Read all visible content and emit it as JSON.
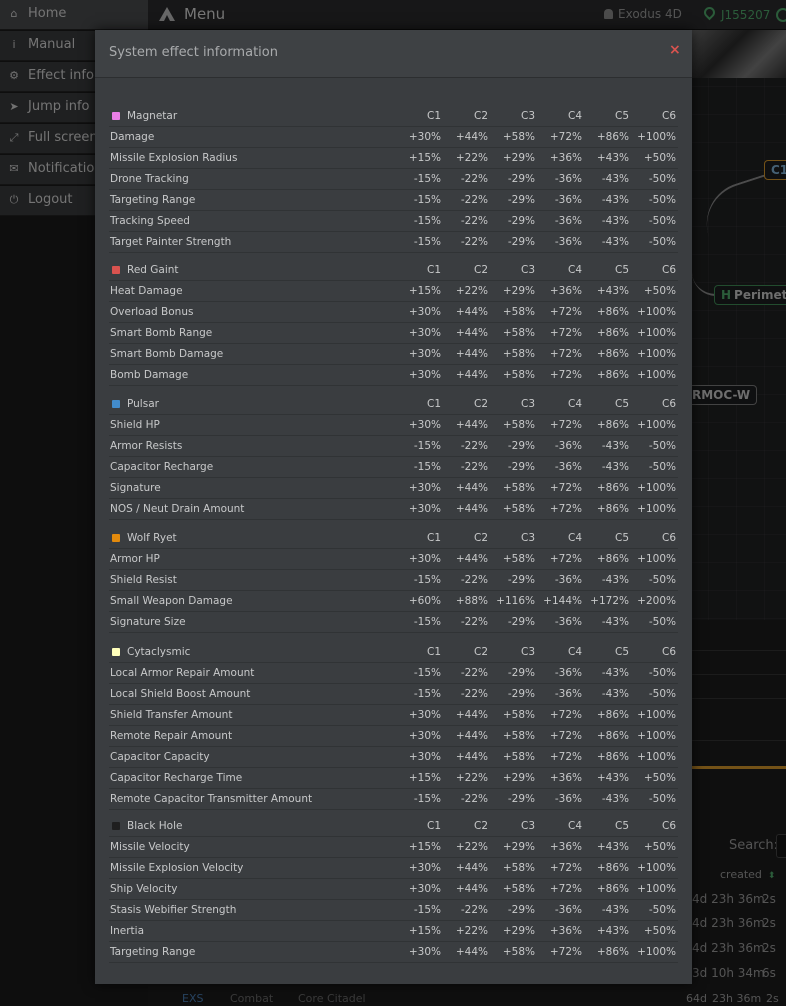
{
  "sidebar": {
    "items": [
      {
        "label": "Home",
        "icon": "home-icon"
      },
      {
        "label": "Manual",
        "icon": "info-icon"
      },
      {
        "label": "Effect info",
        "icon": "gears-icon"
      },
      {
        "label": "Jump info",
        "icon": "plane-icon"
      },
      {
        "label": "Full screen",
        "icon": "expand-icon"
      },
      {
        "label": "Notification",
        "icon": "bell-icon"
      },
      {
        "label": "Logout",
        "icon": "power-icon"
      }
    ]
  },
  "header": {
    "title": "Menu",
    "pilot": "Exodus 4D",
    "system": "J155207"
  },
  "map": {
    "nodes": [
      {
        "id": "c1",
        "label": "C1"
      },
      {
        "id": "perimeter",
        "tag": "H",
        "label": "Perimete"
      },
      {
        "id": "armoc",
        "label": "RMOC-W"
      }
    ]
  },
  "table": {
    "search_label": "Search:",
    "created_header": "created",
    "sort_glyph": "⬍",
    "rows": [
      {
        "age": "4d  23h 36m",
        "sec": "2s"
      },
      {
        "age": "4d  23h 36m",
        "sec": "2s"
      },
      {
        "age": "4d  23h 36m",
        "sec": "2s"
      },
      {
        "age": "3d  10h 34m",
        "sec": "6s"
      }
    ],
    "bottom": {
      "col1": "EXS",
      "col2": "Combat",
      "col3": "Core Citadel",
      "col4": "64d",
      "col5": "23h 36m",
      "col6": "2s"
    }
  },
  "modal": {
    "title": "System effect information",
    "close": "×",
    "columns": [
      "C1",
      "C2",
      "C3",
      "C4",
      "C5",
      "C6"
    ],
    "sections": [
      {
        "name": "Magnetar",
        "color": "#e97fe6",
        "rows": [
          {
            "name": "Damage",
            "values": [
              "+30%",
              "+44%",
              "+58%",
              "+72%",
              "+86%",
              "+100%"
            ]
          },
          {
            "name": "Missile Explosion Radius",
            "values": [
              "+15%",
              "+22%",
              "+29%",
              "+36%",
              "+43%",
              "+50%"
            ]
          },
          {
            "name": "Drone Tracking",
            "values": [
              "-15%",
              "-22%",
              "-29%",
              "-36%",
              "-43%",
              "-50%"
            ]
          },
          {
            "name": "Targeting Range",
            "values": [
              "-15%",
              "-22%",
              "-29%",
              "-36%",
              "-43%",
              "-50%"
            ]
          },
          {
            "name": "Tracking Speed",
            "values": [
              "-15%",
              "-22%",
              "-29%",
              "-36%",
              "-43%",
              "-50%"
            ]
          },
          {
            "name": "Target Painter Strength",
            "values": [
              "-15%",
              "-22%",
              "-29%",
              "-36%",
              "-43%",
              "-50%"
            ]
          }
        ]
      },
      {
        "name": "Red Gaint",
        "color": "#d9534f",
        "rows": [
          {
            "name": "Heat Damage",
            "values": [
              "+15%",
              "+22%",
              "+29%",
              "+36%",
              "+43%",
              "+50%"
            ]
          },
          {
            "name": "Overload Bonus",
            "values": [
              "+30%",
              "+44%",
              "+58%",
              "+72%",
              "+86%",
              "+100%"
            ]
          },
          {
            "name": "Smart Bomb Range",
            "values": [
              "+30%",
              "+44%",
              "+58%",
              "+72%",
              "+86%",
              "+100%"
            ]
          },
          {
            "name": "Smart Bomb Damage",
            "values": [
              "+30%",
              "+44%",
              "+58%",
              "+72%",
              "+86%",
              "+100%"
            ]
          },
          {
            "name": "Bomb Damage",
            "values": [
              "+30%",
              "+44%",
              "+58%",
              "+72%",
              "+86%",
              "+100%"
            ]
          }
        ]
      },
      {
        "name": "Pulsar",
        "color": "#428bca",
        "rows": [
          {
            "name": "Shield HP",
            "values": [
              "+30%",
              "+44%",
              "+58%",
              "+72%",
              "+86%",
              "+100%"
            ]
          },
          {
            "name": "Armor Resists",
            "values": [
              "-15%",
              "-22%",
              "-29%",
              "-36%",
              "-43%",
              "-50%"
            ]
          },
          {
            "name": "Capacitor Recharge",
            "values": [
              "-15%",
              "-22%",
              "-29%",
              "-36%",
              "-43%",
              "-50%"
            ]
          },
          {
            "name": "Signature",
            "values": [
              "+30%",
              "+44%",
              "+58%",
              "+72%",
              "+86%",
              "+100%"
            ]
          },
          {
            "name": "NOS / Neut Drain Amount",
            "values": [
              "+30%",
              "+44%",
              "+58%",
              "+72%",
              "+86%",
              "+100%"
            ]
          }
        ]
      },
      {
        "name": "Wolf Ryet",
        "color": "#e28a0d",
        "rows": [
          {
            "name": "Armor HP",
            "values": [
              "+30%",
              "+44%",
              "+58%",
              "+72%",
              "+86%",
              "+100%"
            ]
          },
          {
            "name": "Shield Resist",
            "values": [
              "-15%",
              "-22%",
              "-29%",
              "-36%",
              "-43%",
              "-50%"
            ]
          },
          {
            "name": "Small Weapon Damage",
            "values": [
              "+60%",
              "+88%",
              "+116%",
              "+144%",
              "+172%",
              "+200%"
            ]
          },
          {
            "name": "Signature Size",
            "values": [
              "-15%",
              "-22%",
              "-29%",
              "-36%",
              "-43%",
              "-50%"
            ]
          }
        ]
      },
      {
        "name": "Cytaclysmic",
        "color": "#ffffbb",
        "rows": [
          {
            "name": "Local Armor Repair Amount",
            "values": [
              "-15%",
              "-22%",
              "-29%",
              "-36%",
              "-43%",
              "-50%"
            ]
          },
          {
            "name": "Local Shield Boost Amount",
            "values": [
              "-15%",
              "-22%",
              "-29%",
              "-36%",
              "-43%",
              "-50%"
            ]
          },
          {
            "name": "Shield Transfer Amount",
            "values": [
              "+30%",
              "+44%",
              "+58%",
              "+72%",
              "+86%",
              "+100%"
            ]
          },
          {
            "name": "Remote Repair Amount",
            "values": [
              "+30%",
              "+44%",
              "+58%",
              "+72%",
              "+86%",
              "+100%"
            ]
          },
          {
            "name": "Capacitor Capacity",
            "values": [
              "+30%",
              "+44%",
              "+58%",
              "+72%",
              "+86%",
              "+100%"
            ]
          },
          {
            "name": "Capacitor Recharge Time",
            "values": [
              "+15%",
              "+22%",
              "+29%",
              "+36%",
              "+43%",
              "+50%"
            ]
          },
          {
            "name": "Remote Capacitor Transmitter Amount",
            "values": [
              "-15%",
              "-22%",
              "-29%",
              "-36%",
              "-43%",
              "-50%"
            ]
          }
        ]
      },
      {
        "name": "Black Hole",
        "color": "#1f1f1f",
        "rows": [
          {
            "name": "Missile Velocity",
            "values": [
              "+15%",
              "+22%",
              "+29%",
              "+36%",
              "+43%",
              "+50%"
            ]
          },
          {
            "name": "Missile Explosion Velocity",
            "values": [
              "+30%",
              "+44%",
              "+58%",
              "+72%",
              "+86%",
              "+100%"
            ]
          },
          {
            "name": "Ship Velocity",
            "values": [
              "+30%",
              "+44%",
              "+58%",
              "+72%",
              "+86%",
              "+100%"
            ]
          },
          {
            "name": "Stasis Webifier Strength",
            "values": [
              "-15%",
              "-22%",
              "-29%",
              "-36%",
              "-43%",
              "-50%"
            ]
          },
          {
            "name": "Inertia",
            "values": [
              "+15%",
              "+22%",
              "+29%",
              "+36%",
              "+43%",
              "+50%"
            ]
          },
          {
            "name": "Targeting Range",
            "values": [
              "+30%",
              "+44%",
              "+58%",
              "+72%",
              "+86%",
              "+100%"
            ]
          }
        ]
      }
    ]
  }
}
